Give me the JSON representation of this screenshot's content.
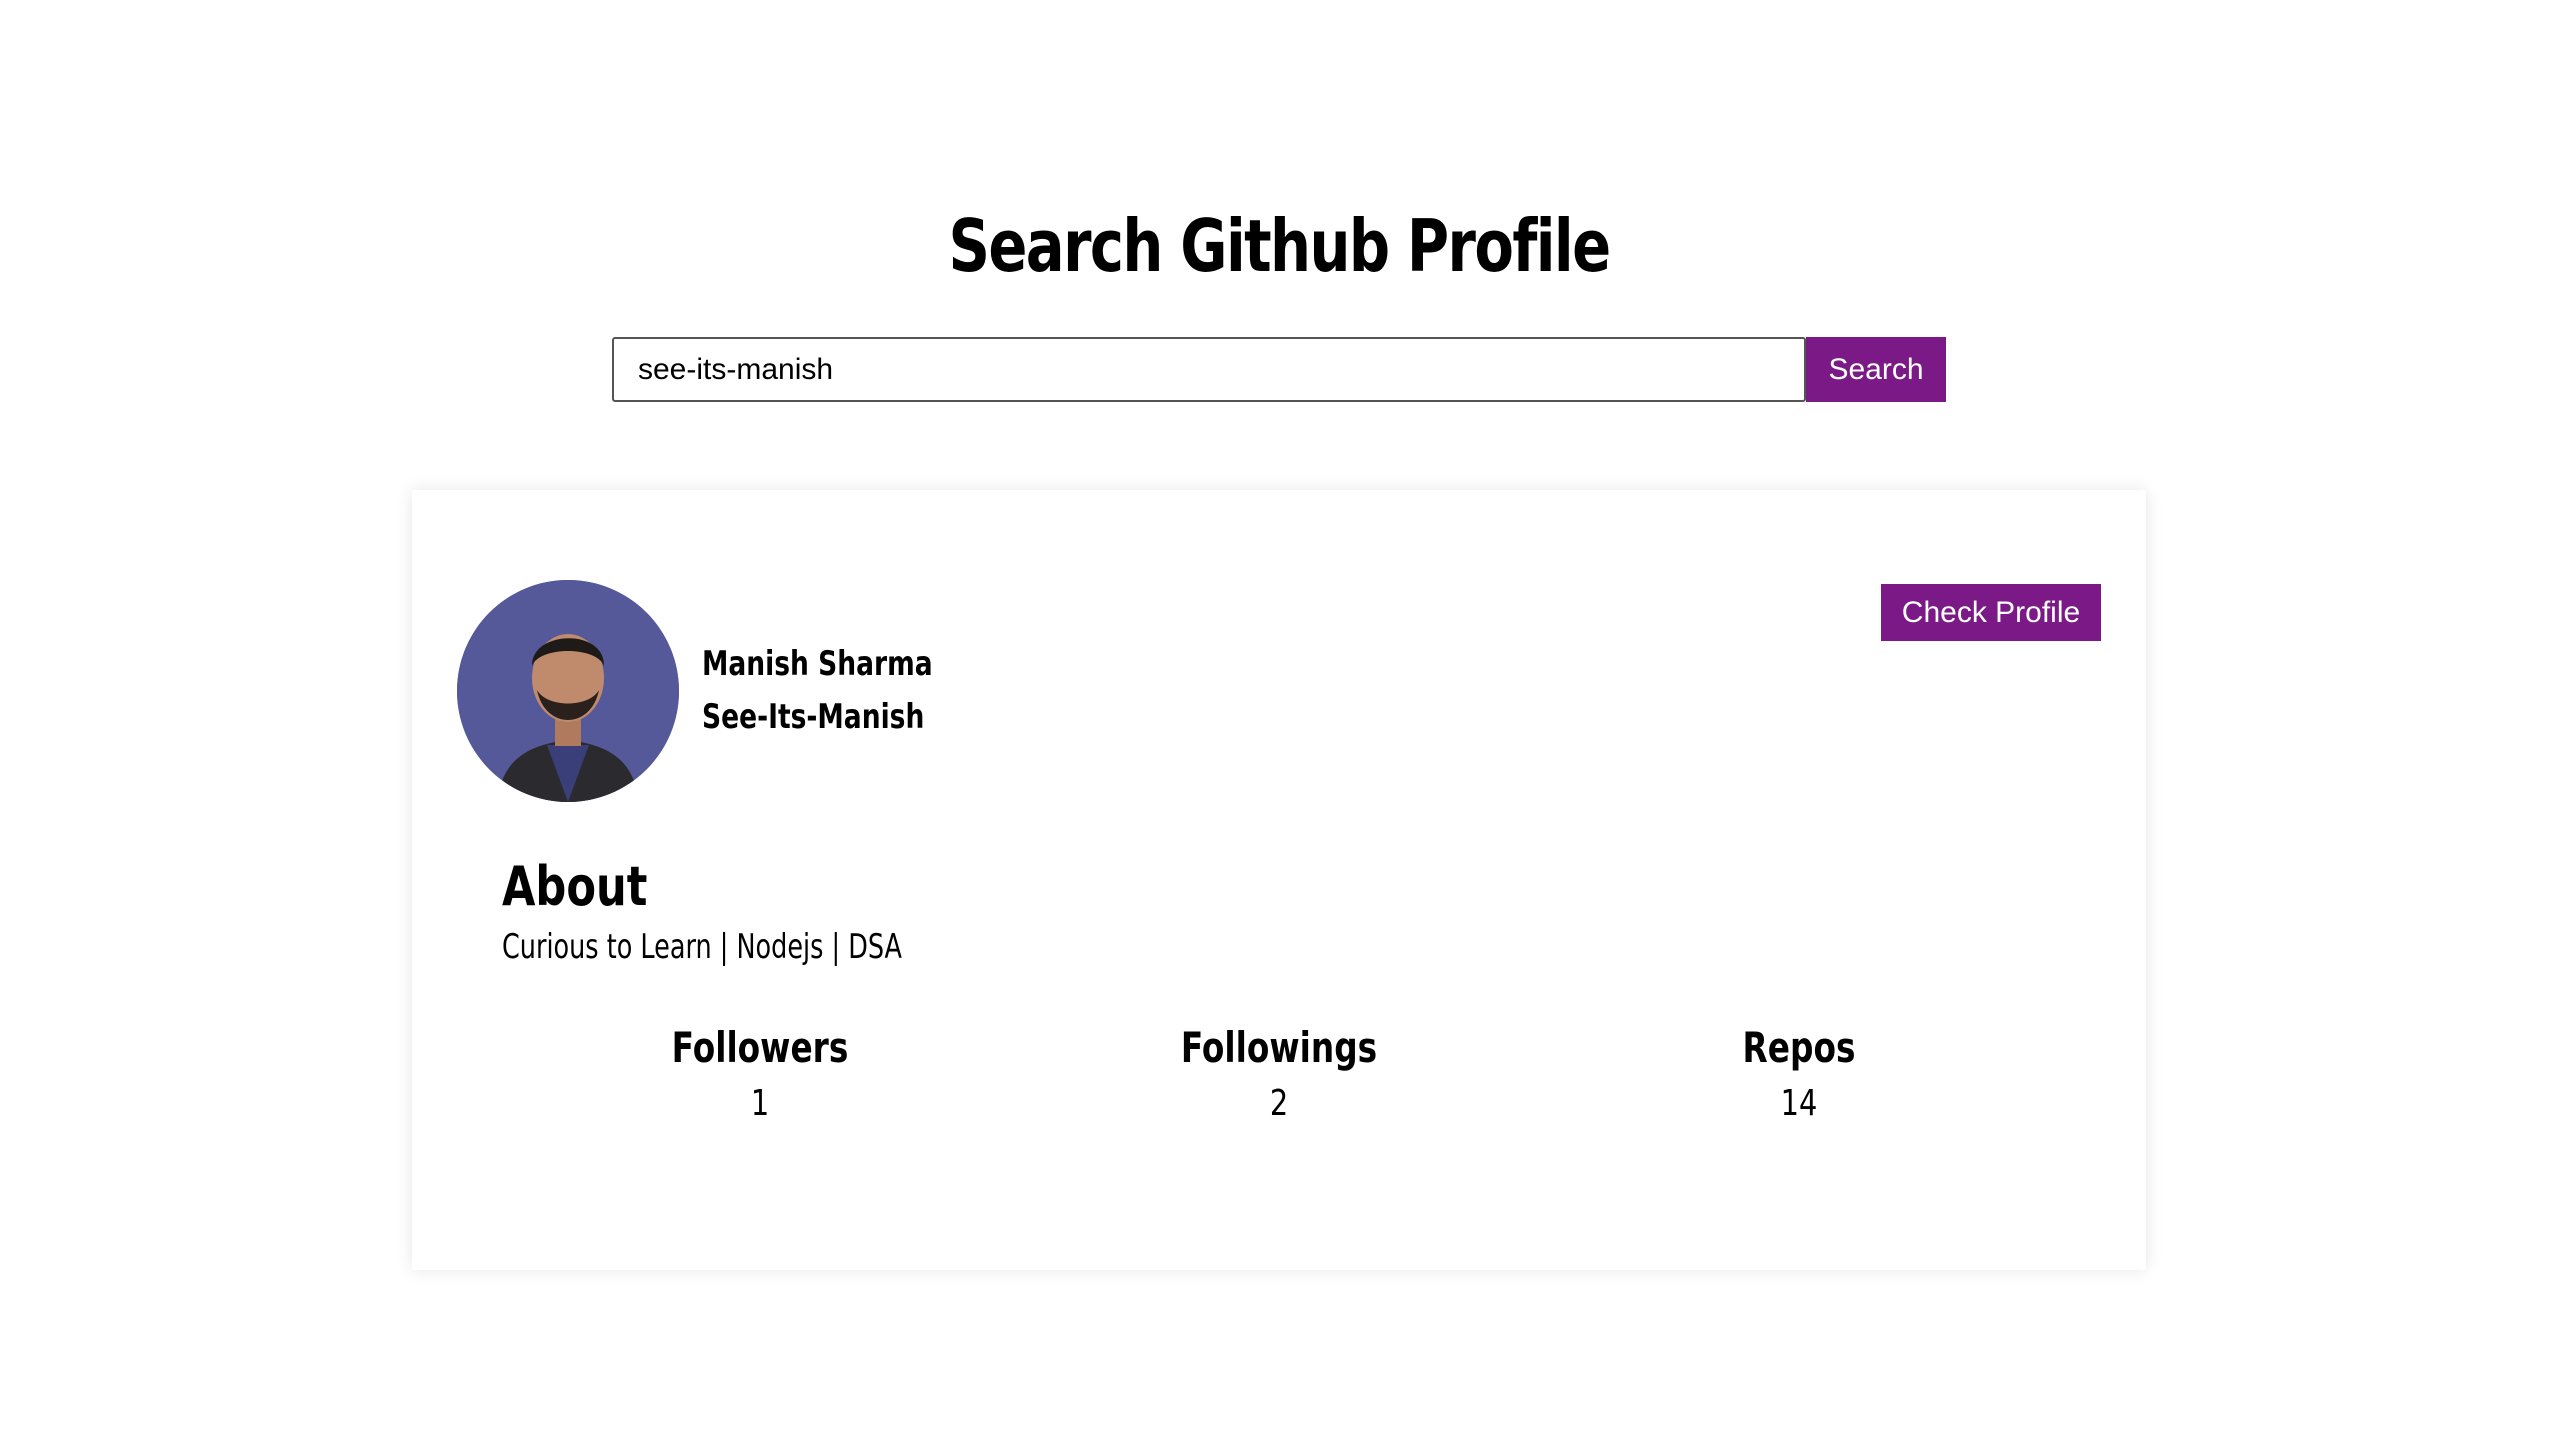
{
  "header": {
    "title": "Search Github Profile"
  },
  "search": {
    "value": "see-its-manish",
    "button_label": "Search"
  },
  "profile": {
    "name": "Manish Sharma",
    "username": "See-Its-Manish",
    "check_profile_label": "Check Profile",
    "avatar_icon": "user-photo",
    "about_heading": "About",
    "bio": "Curious to Learn | Nodejs | DSA",
    "stats": [
      {
        "label": "Followers",
        "value": "1"
      },
      {
        "label": "Followings",
        "value": "2"
      },
      {
        "label": "Repos",
        "value": "14"
      }
    ]
  },
  "colors": {
    "accent": "#7b1a86",
    "avatar_bg": "#55599a"
  }
}
